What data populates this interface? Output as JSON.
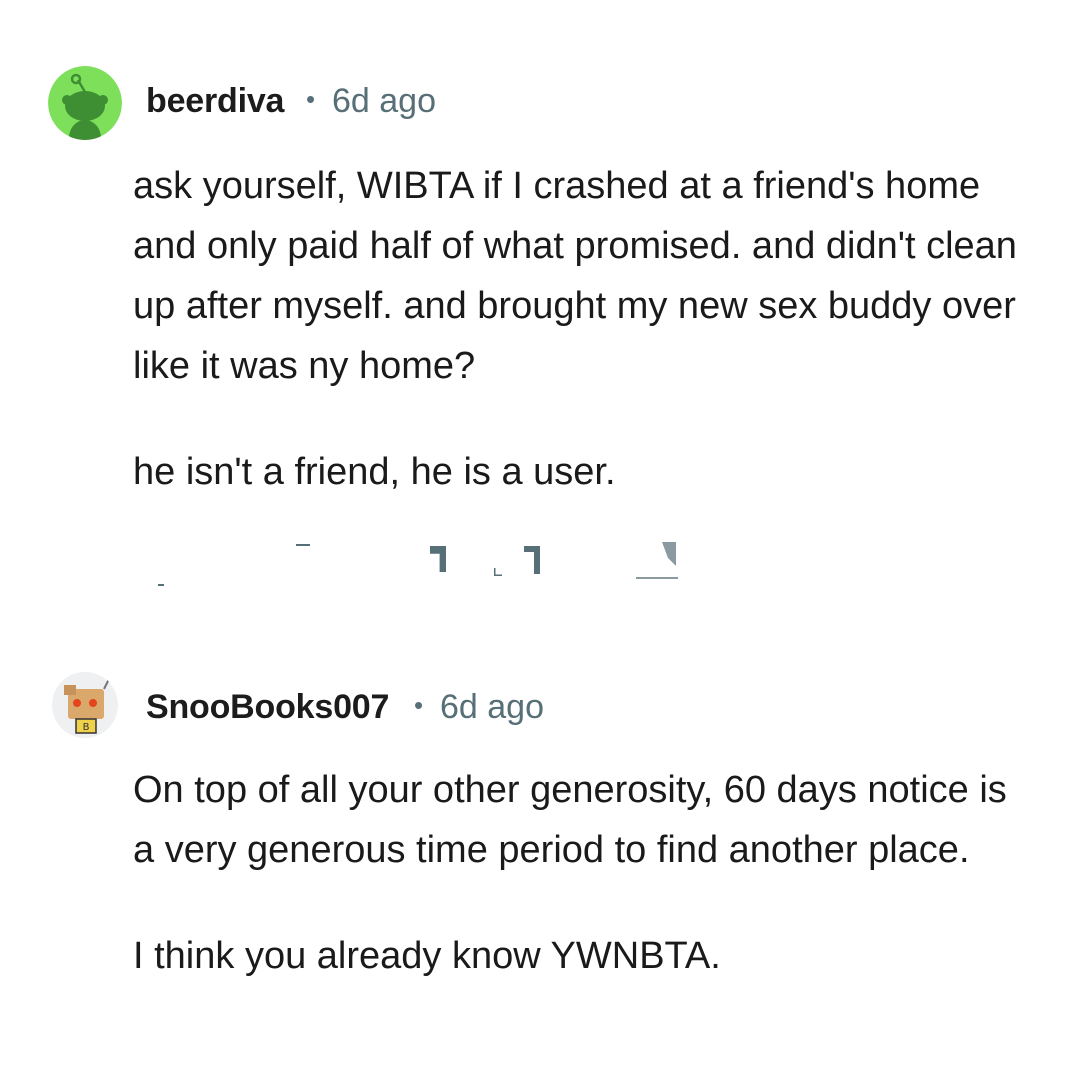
{
  "comments": [
    {
      "author": "beerdiva",
      "separator": "•",
      "time": "6d ago",
      "avatar_icon": "snoo-avatar-green",
      "paragraphs": [
        "ask yourself, WIBTA if I crashed at a friend's home and only paid half of what promised. and didn't clean up after myself. and brought my new sex buddy over like it was ny home?",
        "he isn't a friend, he is a user."
      ]
    },
    {
      "author": "SnooBooks007",
      "separator": "•",
      "time": "6d ago",
      "avatar_icon": "snoo-books-avatar",
      "paragraphs": [
        "On top of all your other generosity, 60 days notice is a very generous time period to find another place.",
        "I think you already know YWNBTA."
      ]
    }
  ],
  "colors": {
    "avatar_green": "#7ee05a",
    "snoo_dark": "#3a8a2e",
    "meta_gray": "#576f76",
    "text": "#1a1a1b"
  }
}
